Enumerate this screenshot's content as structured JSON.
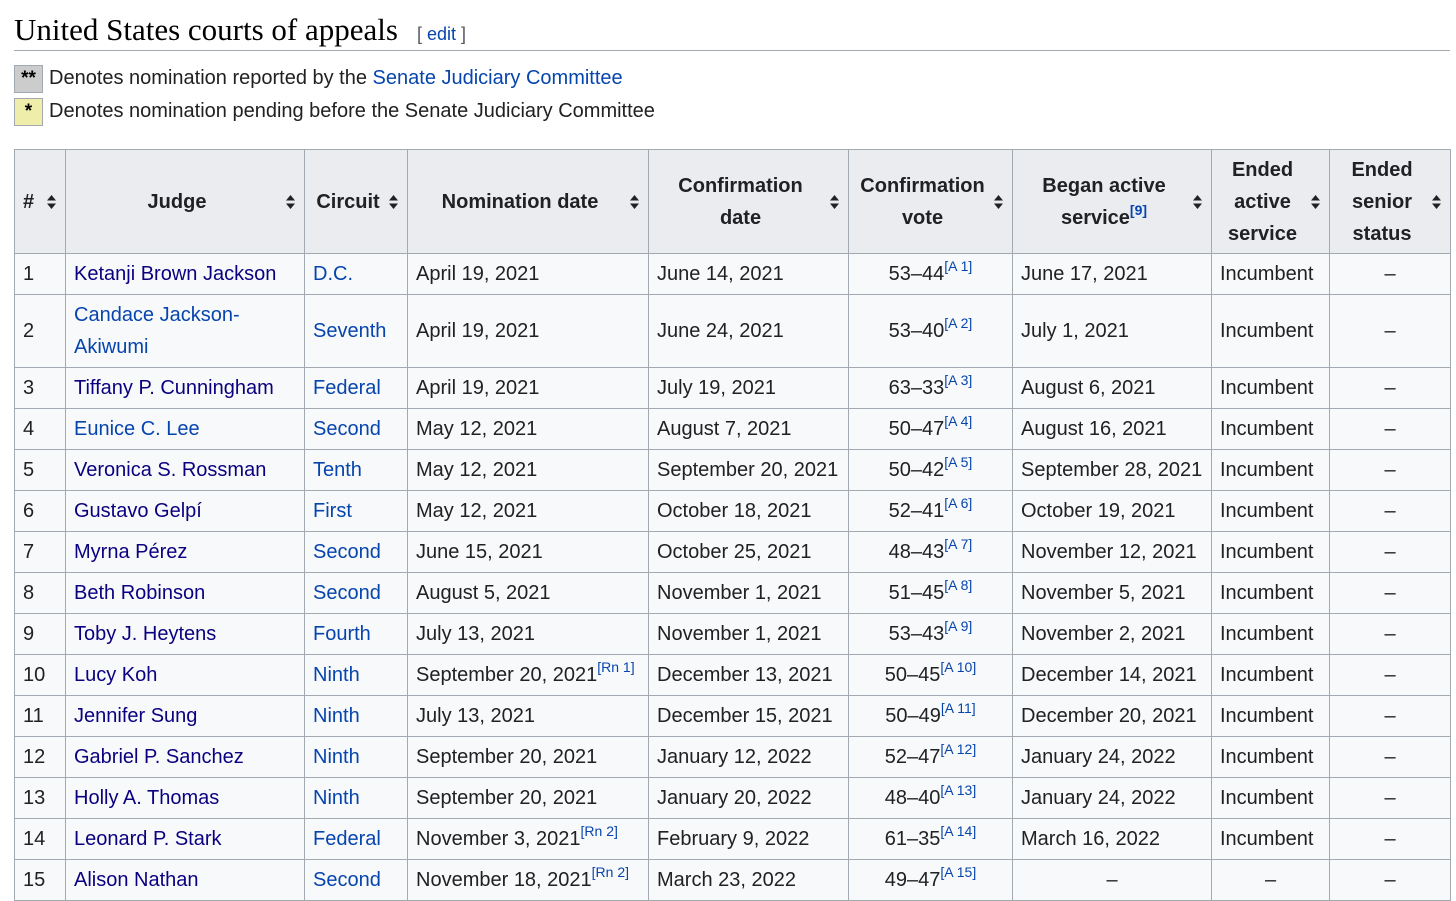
{
  "section": {
    "title": "United States courts of appeals",
    "edit_open": "[ ",
    "edit_label": "edit",
    "edit_close": " ]"
  },
  "legend": [
    {
      "symbol": "**",
      "text_before": "Denotes nomination reported by the ",
      "link": "Senate Judiciary Committee"
    },
    {
      "symbol": "*",
      "text": "Denotes nomination pending before the Senate Judiciary Committee"
    }
  ],
  "columns": [
    {
      "label": "#"
    },
    {
      "label": "Judge"
    },
    {
      "label": "Circuit"
    },
    {
      "label": "Nomination date"
    },
    {
      "label": "Confirmation date"
    },
    {
      "label": "Confirmation vote"
    },
    {
      "label": "Began active service",
      "ref": "[9]"
    },
    {
      "label": "Ended active service"
    },
    {
      "label": "Ended senior status"
    }
  ],
  "rows": [
    {
      "num": "1",
      "judge": "Ketanji Brown Jackson",
      "circuit": "D.C.",
      "nomination": "April 19, 2021",
      "nom_ref": "",
      "confirmation": "June 14, 2021",
      "vote": "53–44",
      "vote_ref": "[A 1]",
      "began": "June 17, 2021",
      "ended_active": "Incumbent",
      "ended_senior": "–"
    },
    {
      "num": "2",
      "judge": "Candace Jackson-Akiwumi",
      "circuit": "Seventh",
      "nomination": "April 19, 2021",
      "nom_ref": "",
      "confirmation": "June 24, 2021",
      "vote": "53–40",
      "vote_ref": "[A 2]",
      "began": "July 1, 2021",
      "ended_active": "Incumbent",
      "ended_senior": "–"
    },
    {
      "num": "3",
      "judge": "Tiffany P. Cunningham",
      "circuit": "Federal",
      "nomination": "April 19, 2021",
      "nom_ref": "",
      "confirmation": "July 19, 2021",
      "vote": "63–33",
      "vote_ref": "[A 3]",
      "began": "August 6, 2021",
      "ended_active": "Incumbent",
      "ended_senior": "–"
    },
    {
      "num": "4",
      "judge": "Eunice C. Lee",
      "circuit": "Second",
      "nomination": "May 12, 2021",
      "nom_ref": "",
      "confirmation": "August 7, 2021",
      "vote": "50–47",
      "vote_ref": "[A 4]",
      "began": "August 16, 2021",
      "ended_active": "Incumbent",
      "ended_senior": "–"
    },
    {
      "num": "5",
      "judge": "Veronica S. Rossman",
      "circuit": "Tenth",
      "nomination": "May 12, 2021",
      "nom_ref": "",
      "confirmation": "September 20, 2021",
      "vote": "50–42",
      "vote_ref": "[A 5]",
      "began": "September 28, 2021",
      "ended_active": "Incumbent",
      "ended_senior": "–"
    },
    {
      "num": "6",
      "judge": "Gustavo Gelpí",
      "circuit": "First",
      "nomination": "May 12, 2021",
      "nom_ref": "",
      "confirmation": "October 18, 2021",
      "vote": "52–41",
      "vote_ref": "[A 6]",
      "began": "October 19, 2021",
      "ended_active": "Incumbent",
      "ended_senior": "–"
    },
    {
      "num": "7",
      "judge": "Myrna Pérez",
      "circuit": "Second",
      "nomination": "June 15, 2021",
      "nom_ref": "",
      "confirmation": "October 25, 2021",
      "vote": "48–43",
      "vote_ref": "[A 7]",
      "began": "November 12, 2021",
      "ended_active": "Incumbent",
      "ended_senior": "–"
    },
    {
      "num": "8",
      "judge": "Beth Robinson",
      "circuit": "Second",
      "nomination": "August 5, 2021",
      "nom_ref": "",
      "confirmation": "November 1, 2021",
      "vote": "51–45",
      "vote_ref": "[A 8]",
      "began": "November 5, 2021",
      "ended_active": "Incumbent",
      "ended_senior": "–"
    },
    {
      "num": "9",
      "judge": "Toby J. Heytens",
      "circuit": "Fourth",
      "nomination": "July 13, 2021",
      "nom_ref": "",
      "confirmation": "November 1, 2021",
      "vote": "53–43",
      "vote_ref": "[A 9]",
      "began": "November 2, 2021",
      "ended_active": "Incumbent",
      "ended_senior": "–"
    },
    {
      "num": "10",
      "judge": "Lucy Koh",
      "circuit": "Ninth",
      "nomination": "September 20, 2021",
      "nom_ref": "[Rn 1]",
      "confirmation": "December 13, 2021",
      "vote": "50–45",
      "vote_ref": "[A 10]",
      "began": "December 14, 2021",
      "ended_active": "Incumbent",
      "ended_senior": "–"
    },
    {
      "num": "11",
      "judge": "Jennifer Sung",
      "circuit": "Ninth",
      "nomination": "July 13, 2021",
      "nom_ref": "",
      "confirmation": "December 15, 2021",
      "vote": "50–49",
      "vote_ref": "[A 11]",
      "began": "December 20, 2021",
      "ended_active": "Incumbent",
      "ended_senior": "–"
    },
    {
      "num": "12",
      "judge": "Gabriel P. Sanchez",
      "circuit": "Ninth",
      "nomination": "September 20, 2021",
      "nom_ref": "",
      "confirmation": "January 12, 2022",
      "vote": "52–47",
      "vote_ref": "[A 12]",
      "began": "January 24, 2022",
      "ended_active": "Incumbent",
      "ended_senior": "–"
    },
    {
      "num": "13",
      "judge": "Holly A. Thomas",
      "circuit": "Ninth",
      "nomination": "September 20, 2021",
      "nom_ref": "",
      "confirmation": "January 20, 2022",
      "vote": "48–40",
      "vote_ref": "[A 13]",
      "began": "January 24, 2022",
      "ended_active": "Incumbent",
      "ended_senior": "–"
    },
    {
      "num": "14",
      "judge": "Leonard P. Stark",
      "circuit": "Federal",
      "nomination": "November 3, 2021",
      "nom_ref": "[Rn 2]",
      "confirmation": "February 9, 2022",
      "vote": "61–35",
      "vote_ref": "[A 14]",
      "began": "March 16, 2022",
      "ended_active": "Incumbent",
      "ended_senior": "–"
    },
    {
      "num": "15",
      "judge": "Alison Nathan",
      "circuit": "Second",
      "nomination": "November 18, 2021",
      "nom_ref": "[Rn 2]",
      "confirmation": "March 23, 2022",
      "vote": "49–47",
      "vote_ref": "[A 15]",
      "began": "–",
      "ended_active": "–",
      "ended_senior": "–"
    }
  ],
  "colors": {
    "link": "#0645ad",
    "visited_link": "#0b0080",
    "header_bg": "#eaecf0",
    "cell_bg": "#f8f9fa",
    "border": "#a2a9b1",
    "reported_swatch": "#cccccc",
    "pending_swatch": "#eeeeaa"
  }
}
